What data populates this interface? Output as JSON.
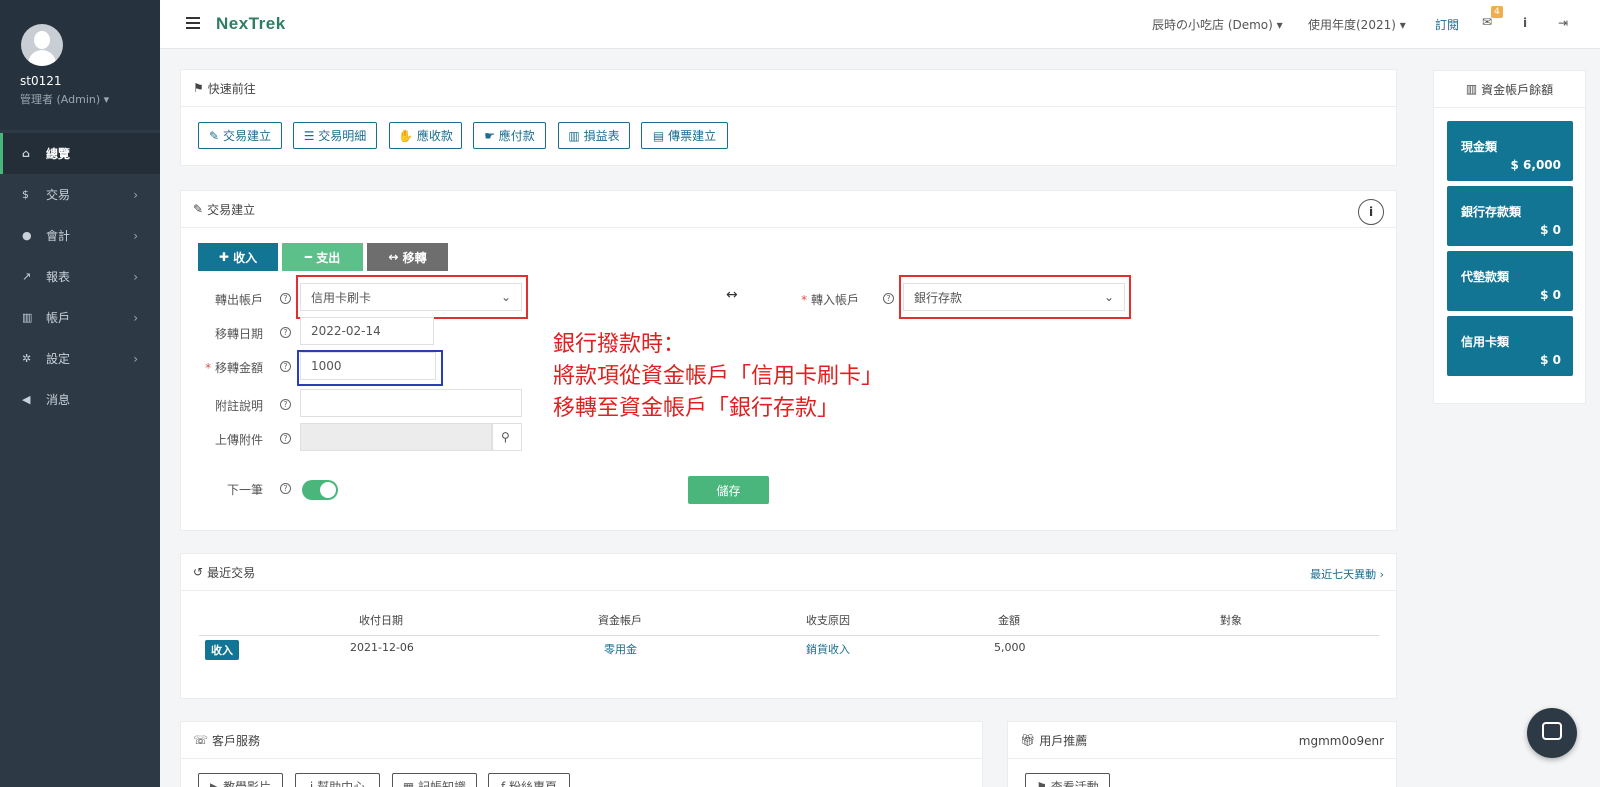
{
  "sidebar": {
    "username": "st0121",
    "role": "管理者 (Admin)",
    "items": [
      {
        "label": "總覽",
        "icon": "home-icon",
        "glyph": "⌂"
      },
      {
        "label": "交易",
        "icon": "dollar-icon",
        "glyph": "$"
      },
      {
        "label": "會計",
        "icon": "user-icon",
        "glyph": "●"
      },
      {
        "label": "報表",
        "icon": "chart-icon",
        "glyph": "↗"
      },
      {
        "label": "帳戶",
        "icon": "bank-icon",
        "glyph": "▥"
      },
      {
        "label": "設定",
        "icon": "gear-icon",
        "glyph": "✲"
      },
      {
        "label": "消息",
        "icon": "megaphone-icon",
        "glyph": "◀"
      }
    ]
  },
  "topbar": {
    "logo": "NexTrek",
    "store": "辰時の小吃店 (Demo)",
    "year": "使用年度(2021)",
    "subscribe": "訂閱",
    "mail_badge": "4"
  },
  "quick": {
    "title": "快速前往",
    "buttons": [
      "交易建立",
      "交易明細",
      "應收款",
      "應付款",
      "損益表",
      "傳票建立"
    ]
  },
  "transaction": {
    "title": "交易建立",
    "tabs": {
      "income": "收入",
      "expense": "支出",
      "transfer": "移轉"
    },
    "from_label": "轉出帳戶",
    "from_value": "信用卡刷卡",
    "to_label": "轉入帳戶",
    "to_value": "銀行存款",
    "date_label": "移轉日期",
    "date_value": "2022-02-14",
    "amount_label": "移轉金額",
    "amount_value": "1000",
    "note_label": "附註說明",
    "upload_label": "上傳附件",
    "next_label": "下一筆",
    "save": "儲存",
    "arrow": "↔"
  },
  "annotation": {
    "line1": "銀行撥款時：",
    "line2": "將款項從資金帳戶「信用卡刷卡」",
    "line3": "移轉至資金帳戶「銀行存款」"
  },
  "balances": {
    "title": "資金帳戶餘額",
    "cards": [
      {
        "label": "現金類",
        "value": "$ 6,000"
      },
      {
        "label": "銀行存款類",
        "value": "$ 0"
      },
      {
        "label": "代墊款類",
        "value": "$ 0"
      },
      {
        "label": "信用卡類",
        "value": "$ 0"
      }
    ]
  },
  "recent": {
    "title": "最近交易",
    "link": "最近七天異動",
    "headers": [
      "收付日期",
      "資金帳戶",
      "收支原因",
      "金額",
      "對象"
    ],
    "row": {
      "type": "收入",
      "date": "2021-12-06",
      "account": "零用金",
      "reason": "銷貨收入",
      "amount": "5,000",
      "target": ""
    }
  },
  "service": {
    "title": "客戶服務",
    "buttons": [
      "教學影片",
      "幫助中心",
      "記帳知識",
      "粉絲專頁"
    ]
  },
  "referral": {
    "title": "用戶推薦",
    "code": "mgmm0o9enr",
    "button": "查看活動"
  },
  "colors": {
    "accent": "#127594",
    "green": "#4bb67c",
    "sidebar": "#2d3a46",
    "annotation": "#e02020"
  }
}
